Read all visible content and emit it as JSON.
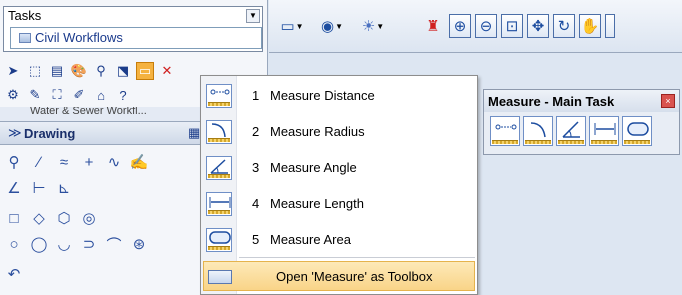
{
  "tasks_panel": {
    "title": "Tasks",
    "workflow": "Civil Workflows",
    "collapsed_section": "Water & Sewer Workfl...",
    "drawing_section": "Drawing"
  },
  "top_toolbar": {
    "icons": [
      "view-toggle-icon",
      "display-style-icon",
      "lighting-icon",
      "paint-brush-icon",
      "zoom-in-icon",
      "zoom-out-icon",
      "window-area-icon",
      "fit-view-icon",
      "rotate-view-icon",
      "pan-hand-icon"
    ]
  },
  "measure_menu": {
    "items": [
      {
        "num": "1",
        "label": "Measure Distance"
      },
      {
        "num": "2",
        "label": "Measure Radius"
      },
      {
        "num": "3",
        "label": "Measure Angle"
      },
      {
        "num": "4",
        "label": "Measure Length"
      },
      {
        "num": "5",
        "label": "Measure Area"
      }
    ],
    "toolbox_option": "Open 'Measure' as Toolbox"
  },
  "measure_toolbox": {
    "title": "Measure - Main Task",
    "close_glyph": "×"
  },
  "colors": {
    "highlight": "#f9d488",
    "active_tool": "#f5b240",
    "accent_blue": "#1d4da0",
    "close_red": "#d9534f"
  }
}
